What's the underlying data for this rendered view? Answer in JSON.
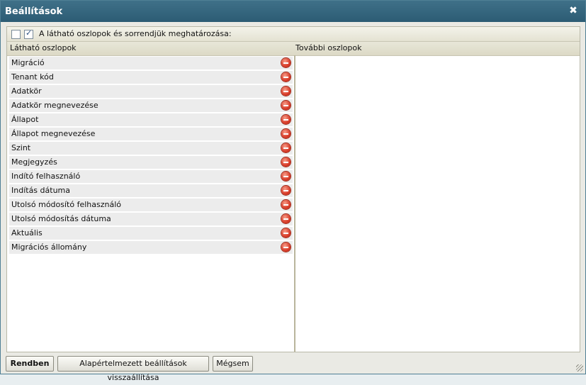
{
  "window": {
    "title": "Beállítások"
  },
  "toolbar": {
    "label": "A látható oszlopok és sorrendjük meghatározása:"
  },
  "columns": {
    "visible_header": "Látható oszlopok",
    "other_header": "További oszlopok"
  },
  "visible_columns": [
    "Migráció",
    "Tenant kód",
    "Adatkör",
    "Adatkör megnevezése",
    "Állapot",
    "Állapot megnevezése",
    "Szint",
    "Megjegyzés",
    "Indító felhasználó",
    "Indítás dátuma",
    "Utolsó módosító felhasználó",
    "Utolsó módosítás dátuma",
    "Aktuális",
    "Migrációs állomány"
  ],
  "buttons": {
    "ok": "Rendben",
    "reset": "Alapértelmezett beállítások visszaállítása",
    "cancel": "Mégsem"
  },
  "icons": {
    "close": "close-icon",
    "remove": "remove-circle-icon"
  }
}
